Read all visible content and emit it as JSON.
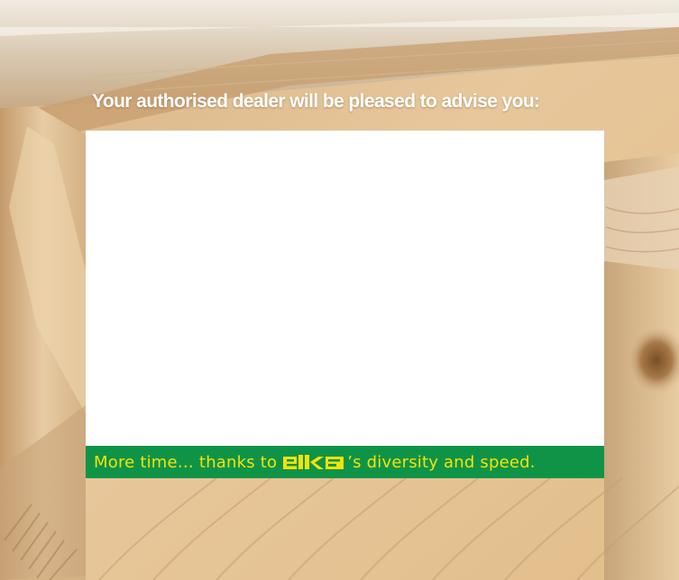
{
  "heading": "Your authorised dealer will be pleased to advise you:",
  "slogan": {
    "before": "More time… thanks to",
    "after": "’s diversity and speed."
  },
  "logo": {
    "text": "elka",
    "icon": "elka-logo"
  },
  "colors": {
    "slogan_background": "#0f9447",
    "slogan_text": "#f6e20a",
    "heading_text": "#ffffff",
    "box_background": "#ffffff"
  }
}
